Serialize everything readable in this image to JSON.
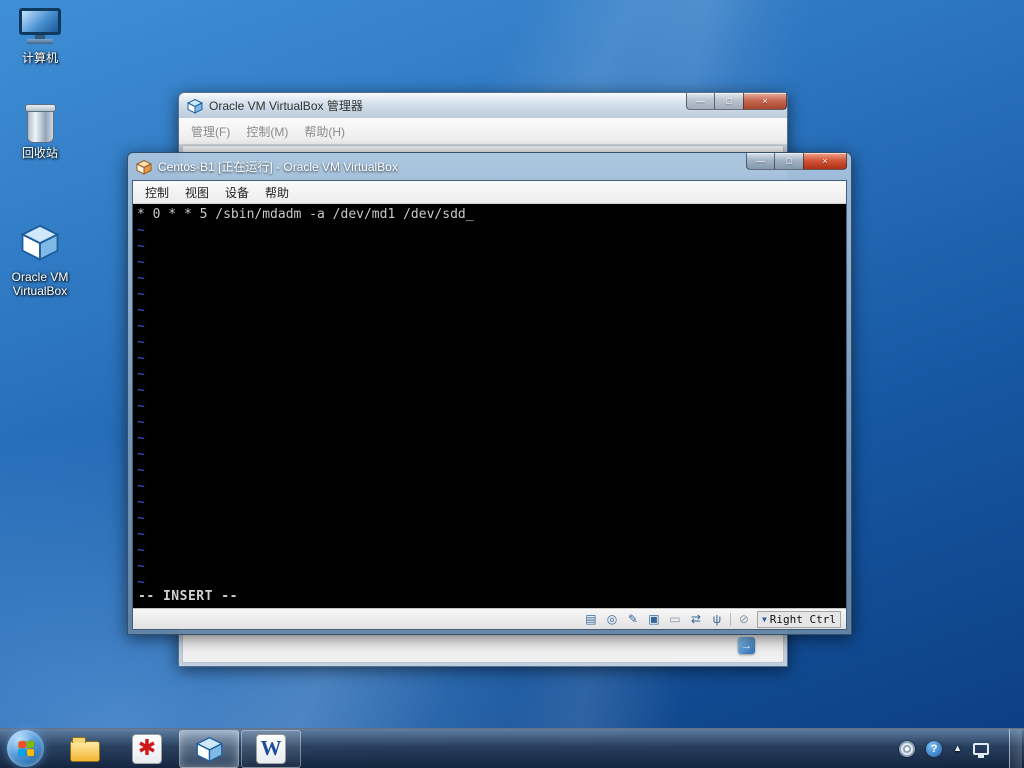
{
  "desktop": {
    "icons": [
      {
        "name": "computer",
        "label": "计算机"
      },
      {
        "name": "recycle-bin",
        "label": "回收站"
      },
      {
        "name": "virtualbox",
        "label": "Oracle VM VirtualBox"
      }
    ]
  },
  "manager_window": {
    "title": "Oracle VM VirtualBox 管理器",
    "menus": [
      "管理(F)",
      "控制(M)",
      "帮助(H)"
    ]
  },
  "vm_window": {
    "title": "Centos-B1 [正在运行] - Oracle VM VirtualBox",
    "menus": [
      "控制",
      "视图",
      "设备",
      "帮助"
    ],
    "terminal": {
      "command_line": "* 0 * * 5 /sbin/mdadm -a /dev/md1 /dev/sdd",
      "cursor": "_",
      "tilde": "~",
      "tilde_count": 23,
      "mode_line": "-- INSERT --"
    },
    "status_bar": {
      "host_key_label": "Right Ctrl"
    }
  },
  "taskbar": {
    "help_badge": "?"
  },
  "glyphs": {
    "minimize": "—",
    "maximize": "□",
    "close": "×",
    "hdd": "▤",
    "optical": "◎",
    "recording": "✎",
    "shared_folders": "▣",
    "display": "▭",
    "network": "⇄",
    "usb": "ψ",
    "mouse": "⊘",
    "host_key_arrow": "▼",
    "tray_arrow": "▲",
    "word_initial": "W",
    "media_flower": "✱",
    "corner_arrow": "→"
  },
  "colors": {
    "accent_blue": "#2f7fd0",
    "close_red": "#c9452f",
    "terminal_text": "#c9c9c9",
    "vim_tilde_blue": "#3d55e0"
  }
}
